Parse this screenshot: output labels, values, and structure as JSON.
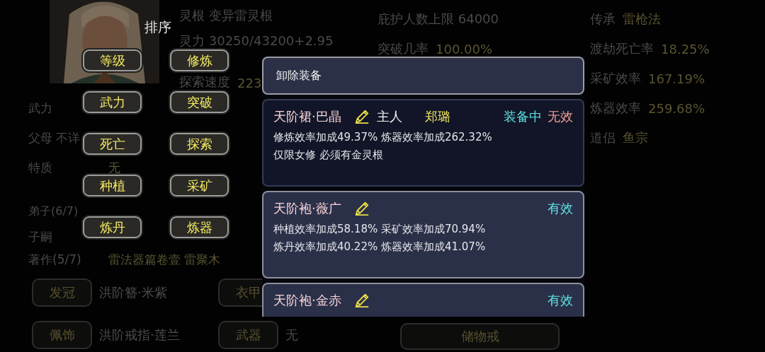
{
  "sort_panel": {
    "title": "排序",
    "buttons": [
      "等级",
      "修炼",
      "武力",
      "突破",
      "死亡",
      "探索",
      "种植",
      "采矿",
      "炼丹",
      "炼器"
    ]
  },
  "stats_left_top": [
    {
      "label": "灵根 变异雷灵根"
    },
    {
      "label": "灵力 30250/43200+2.95"
    },
    {
      "label": "探索速度",
      "value": "223"
    }
  ],
  "stats_left": [
    {
      "label": "武力"
    },
    {
      "label": "父母 不详"
    },
    {
      "label": "特质",
      "value": "无"
    },
    {
      "label": "弟子(6/7)"
    },
    {
      "label": "子嗣"
    },
    {
      "label": "著作(5/7)",
      "value": "雷法器篇卷壹 雷聚木"
    }
  ],
  "stats_middle": [
    {
      "label": "庇护人数上限 64000"
    },
    {
      "label": "突破几率",
      "value": "100.00%"
    }
  ],
  "stats_right": [
    {
      "label": "传承",
      "value": "雷枪法"
    },
    {
      "label": "渡劫死亡率",
      "value": "18.25%"
    },
    {
      "label": "采矿效率",
      "value": "167.19%"
    },
    {
      "label": "炼器效率",
      "value": "259.68%"
    },
    {
      "label": "道侣",
      "value": "鱼宗"
    }
  ],
  "slots": [
    {
      "slot": "发冠",
      "item": "洪阶簪·米紫"
    },
    {
      "slot": "衣甲"
    },
    {
      "slot": "佩饰",
      "item": "洪阶戒指·莲兰"
    },
    {
      "slot": "武器",
      "item": "无"
    }
  ],
  "storage_button": "储物戒",
  "equipment_popup": {
    "unequip_button": "卸除装备",
    "items": [
      {
        "name": "天阶裙·巴晶",
        "owner_label": "主人",
        "owner": "郑璐",
        "equip_status": "装备中",
        "equipped": true,
        "status": "无效",
        "valid": false,
        "effects": [
          "修炼效率加成49.37% 炼器效率加成262.32%",
          "仅限女修 必须有金灵根"
        ]
      },
      {
        "name": "天阶袍·薇广",
        "equipped": false,
        "status": "有效",
        "valid": true,
        "effects": [
          "种植效率加成58.18% 采矿效率加成70.94%",
          "炼丹效率加成40.22% 炼器效率加成41.07%"
        ]
      },
      {
        "name": "天阶袍·金赤",
        "equipped": false,
        "status": "有效",
        "valid": true
      }
    ]
  }
}
